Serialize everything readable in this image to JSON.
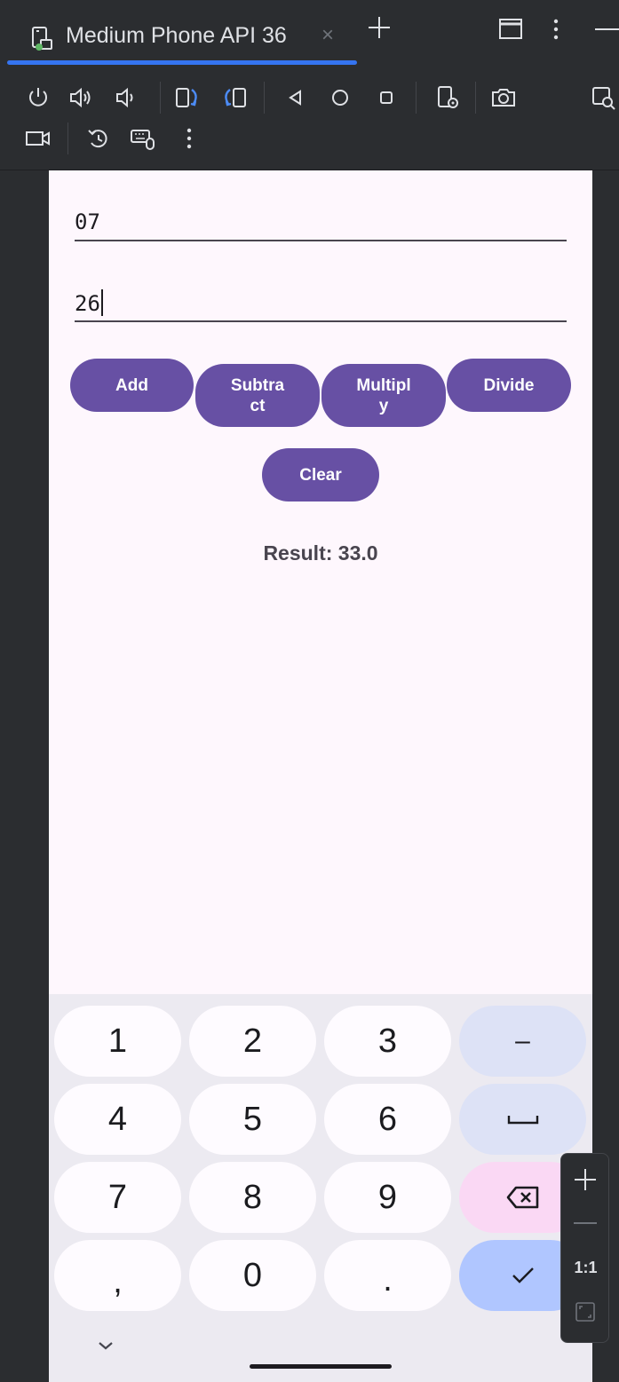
{
  "window": {
    "tab_title": "Medium Phone API 36",
    "tab_close": "×"
  },
  "toolbar": {
    "icons": [
      "power-icon",
      "volume-up-icon",
      "volume-down-icon",
      "rotate-left-icon",
      "rotate-right-icon",
      "back-icon",
      "home-icon",
      "overview-icon",
      "device-settings-icon",
      "screenshot-icon",
      "zoom-screen-icon",
      "screen-record-icon",
      "snapshot-icon",
      "keyboard-mouse-icon",
      "more-icon"
    ]
  },
  "app": {
    "field1": {
      "value": "07"
    },
    "field2": {
      "value": "26"
    },
    "buttons": {
      "add": "Add",
      "subtract": "Subtra\nct",
      "multiply": "Multipl\ny",
      "divide": "Divide",
      "clear": "Clear"
    },
    "result": "Result: 33.0"
  },
  "keyboard": {
    "rows": [
      [
        "1",
        "2",
        "3",
        "–"
      ],
      [
        "4",
        "5",
        "6",
        "␣"
      ],
      [
        "7",
        "8",
        "9",
        "⌫"
      ],
      [
        ",",
        "0",
        ".",
        "✓"
      ]
    ]
  },
  "zoom": {
    "ratio_label": "1:1"
  },
  "colors": {
    "accent": "#3574f0",
    "button": "#6750a4",
    "screen_bg": "#fef7fd",
    "enter_key": "#b0c6ff",
    "delete_key": "#fad8f4"
  }
}
